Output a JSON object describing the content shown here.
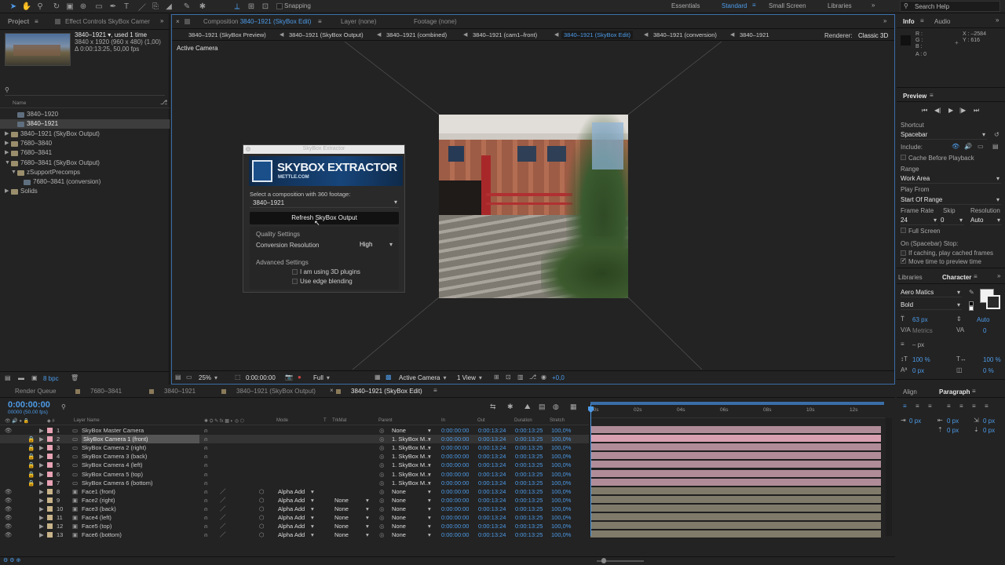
{
  "toolbar": {
    "snapping_label": "Snapping",
    "workspaces": [
      "Essentials",
      "Standard",
      "Small Screen",
      "Libraries"
    ],
    "active_workspace": "Standard",
    "search_placeholder": "Search Help"
  },
  "project": {
    "tab_label": "Project",
    "effect_controls_tab": "Effect Controls SkyBox Camer",
    "selected_name": "3840–1921 ▾, used 1 time",
    "selected_dims": "3840 x 1920  (960 x 480) (1,00)",
    "selected_duration": "Δ 0:00:13:25, 50,00 fps",
    "search_icon": "search-icon",
    "name_header": "Name",
    "items": [
      {
        "label": "3840–1920",
        "indent": 1,
        "kind": "comp"
      },
      {
        "label": "3840–1921",
        "indent": 1,
        "kind": "comp",
        "selected": true
      },
      {
        "label": "3840–1921 (SkyBox Output)",
        "indent": 0,
        "kind": "folder"
      },
      {
        "label": "7680–3840",
        "indent": 0,
        "kind": "folder"
      },
      {
        "label": "7680–3841",
        "indent": 0,
        "kind": "folder"
      },
      {
        "label": "7680–3841 (SkyBox Output)",
        "indent": 0,
        "kind": "folder-open"
      },
      {
        "label": "zSupportPrecomps",
        "indent": 1,
        "kind": "folder-open"
      },
      {
        "label": "7680–3841 (conversion)",
        "indent": 2,
        "kind": "comp"
      },
      {
        "label": "Solids",
        "indent": 0,
        "kind": "folder"
      }
    ],
    "bpc_label": "8 bpc"
  },
  "composition": {
    "tab_label": "Composition",
    "tab_name": "3840–1921 (SkyBox Edit)",
    "layer_tab": "Layer (none)",
    "footage_tab": "Footage (none)",
    "breadcrumbs": [
      "3840–1921 (SkyBox Preview)",
      "3840–1921 (SkyBox Output)",
      "3840–1921 (combined)",
      "3840–1921 (cam1–front)",
      "3840–1921 (SkyBox Edit)",
      "3840–1921 (conversion)",
      "3840–1921"
    ],
    "active_crumb": 4,
    "renderer_label": "Renderer:",
    "renderer_value": "Classic 3D",
    "viewer_label": "Active Camera",
    "footer": {
      "zoom": "25%",
      "timecode": "0:00:00:00",
      "resolution": "Full",
      "camera": "Active Camera",
      "views": "1 View",
      "exposure": "+0,0"
    }
  },
  "skybox": {
    "window_title": "SkyBox Extractor",
    "logo_main": "SKYBOX EXTRACTOR",
    "logo_sub": "METTLE.COM",
    "select_label": "Select a composition with 360 footage:",
    "select_value": "3840–1921",
    "refresh_button": "Refresh SkyBox Output",
    "quality_heading": "Quality Settings",
    "conversion_label": "Conversion Resolution",
    "conversion_value": "High",
    "advanced_heading": "Advanced Settings",
    "check_3d": "I am using 3D plugins",
    "check_edge": "Use edge blending"
  },
  "info": {
    "tab_label": "Info",
    "audio_tab": "Audio",
    "r": "R :",
    "g": "G :",
    "b": "B :",
    "a": "A : 0",
    "x": "X : –2584",
    "y": "Y : 616"
  },
  "preview": {
    "title": "Preview",
    "shortcut_label": "Shortcut",
    "shortcut_value": "Spacebar",
    "include_label": "Include:",
    "cache_label": "Cache Before Playback",
    "range_label": "Range",
    "range_value": "Work Area",
    "play_from_label": "Play From",
    "play_from_value": "Start Of Range",
    "frame_rate_label": "Frame Rate",
    "skip_label": "Skip",
    "resolution_label": "Resolution",
    "frame_rate_value": "24",
    "skip_value": "0",
    "resolution_value": "Auto",
    "full_screen": "Full Screen",
    "stop_label": "On (Spacebar) Stop:",
    "stop_opt1": "If caching, play cached frames",
    "stop_opt2": "Move time to preview time"
  },
  "character": {
    "libraries_tab": "Libraries",
    "tab_label": "Character",
    "font": "Aero Matics",
    "style": "Bold",
    "size": "63 px",
    "leading": "Auto",
    "kerning": "Metrics",
    "tracking": "0",
    "stroke": "– px",
    "vscale": "100 %",
    "hscale": "100 %",
    "baseline": "0 px",
    "tsume": "0 %"
  },
  "paragraph": {
    "align_tab": "Align",
    "tab_label": "Paragraph",
    "values": [
      "0 px",
      "0 px",
      "0 px",
      "0 px",
      "0 px"
    ]
  },
  "timeline": {
    "tabs": [
      "Render Queue",
      "7680–3841",
      "3840–1921",
      "3840–1921 (SkyBox Output)",
      "3840–1921 (SkyBox Edit)"
    ],
    "active_tab": 4,
    "timecode": "0:00:00:00",
    "fps": "00000 (50.00 fps)",
    "headers": {
      "layer_name": "Layer Name",
      "mode": "Mode",
      "t": "T",
      "trkmat": "TrkMat",
      "parent": "Parent",
      "in": "In",
      "out": "Out",
      "duration": "Duration",
      "stretch": "Stretch"
    },
    "ruler": [
      "00s",
      "02s",
      "04s",
      "06s",
      "08s",
      "10s",
      "12s"
    ],
    "layers": [
      {
        "num": "1",
        "name": "SkyBox Master Camera",
        "mode": "",
        "trkmat": "",
        "parent": "None",
        "in": "0:00:00:00",
        "out": "0:00:13:24",
        "dur": "0:00:13:25",
        "stretch": "100,0%",
        "color": "#e8a3b4",
        "type": "camera"
      },
      {
        "num": "2",
        "name": "SkyBox Camera 1 (front)",
        "mode": "",
        "trkmat": "",
        "parent": "1. SkyBox M…",
        "in": "0:00:00:00",
        "out": "0:00:13:24",
        "dur": "0:00:13:25",
        "stretch": "100,0%",
        "color": "#e8a3b4",
        "type": "camera",
        "selected": true
      },
      {
        "num": "3",
        "name": "SkyBox Camera 2 (right)",
        "mode": "",
        "trkmat": "",
        "parent": "1. SkyBox M…",
        "in": "0:00:00:00",
        "out": "0:00:13:24",
        "dur": "0:00:13:25",
        "stretch": "100,0%",
        "color": "#e8a3b4",
        "type": "camera"
      },
      {
        "num": "4",
        "name": "SkyBox Camera 3 (back)",
        "mode": "",
        "trkmat": "",
        "parent": "1. SkyBox M…",
        "in": "0:00:00:00",
        "out": "0:00:13:24",
        "dur": "0:00:13:25",
        "stretch": "100,0%",
        "color": "#e8a3b4",
        "type": "camera"
      },
      {
        "num": "5",
        "name": "SkyBox Camera 4 (left)",
        "mode": "",
        "trkmat": "",
        "parent": "1. SkyBox M…",
        "in": "0:00:00:00",
        "out": "0:00:13:24",
        "dur": "0:00:13:25",
        "stretch": "100,0%",
        "color": "#e8a3b4",
        "type": "camera"
      },
      {
        "num": "6",
        "name": "SkyBox Camera 5 (top)",
        "mode": "",
        "trkmat": "",
        "parent": "1. SkyBox M…",
        "in": "0:00:00:00",
        "out": "0:00:13:24",
        "dur": "0:00:13:25",
        "stretch": "100,0%",
        "color": "#e8a3b4",
        "type": "camera"
      },
      {
        "num": "7",
        "name": "SkyBox Camera 6 (bottom)",
        "mode": "",
        "trkmat": "",
        "parent": "1. SkyBox M…",
        "in": "0:00:00:00",
        "out": "0:00:13:24",
        "dur": "0:00:13:25",
        "stretch": "100,0%",
        "color": "#e8a3b4",
        "type": "camera"
      },
      {
        "num": "8",
        "name": "Face1 (front)",
        "mode": "Alpha Add",
        "trkmat": "",
        "parent": "None",
        "in": "0:00:00:00",
        "out": "0:00:13:24",
        "dur": "0:00:13:25",
        "stretch": "100,0%",
        "color": "#c9b48a",
        "type": "comp"
      },
      {
        "num": "9",
        "name": "Face2 (right)",
        "mode": "Alpha Add",
        "trkmat": "None",
        "parent": "None",
        "in": "0:00:00:00",
        "out": "0:00:13:24",
        "dur": "0:00:13:25",
        "stretch": "100,0%",
        "color": "#c9b48a",
        "type": "comp"
      },
      {
        "num": "10",
        "name": "Face3 (back)",
        "mode": "Alpha Add",
        "trkmat": "None",
        "parent": "None",
        "in": "0:00:00:00",
        "out": "0:00:13:24",
        "dur": "0:00:13:25",
        "stretch": "100,0%",
        "color": "#c9b48a",
        "type": "comp"
      },
      {
        "num": "11",
        "name": "Face4 (left)",
        "mode": "Alpha Add",
        "trkmat": "None",
        "parent": "None",
        "in": "0:00:00:00",
        "out": "0:00:13:24",
        "dur": "0:00:13:25",
        "stretch": "100,0%",
        "color": "#c9b48a",
        "type": "comp"
      },
      {
        "num": "12",
        "name": "Face5 (top)",
        "mode": "Alpha Add",
        "trkmat": "None",
        "parent": "None",
        "in": "0:00:00:00",
        "out": "0:00:13:24",
        "dur": "0:00:13:25",
        "stretch": "100,0%",
        "color": "#c9b48a",
        "type": "comp"
      },
      {
        "num": "13",
        "name": "Face6 (bottom)",
        "mode": "Alpha Add",
        "trkmat": "None",
        "parent": "None",
        "in": "0:00:00:00",
        "out": "0:00:13:24",
        "dur": "0:00:13:25",
        "stretch": "100,0%",
        "color": "#c9b48a",
        "type": "comp"
      }
    ]
  },
  "colors": {
    "accent": "#4d9be8",
    "camera_bar": "#b08c99",
    "comp_bar": "#7f7a6a",
    "selected_bar": "#d89fb0"
  }
}
